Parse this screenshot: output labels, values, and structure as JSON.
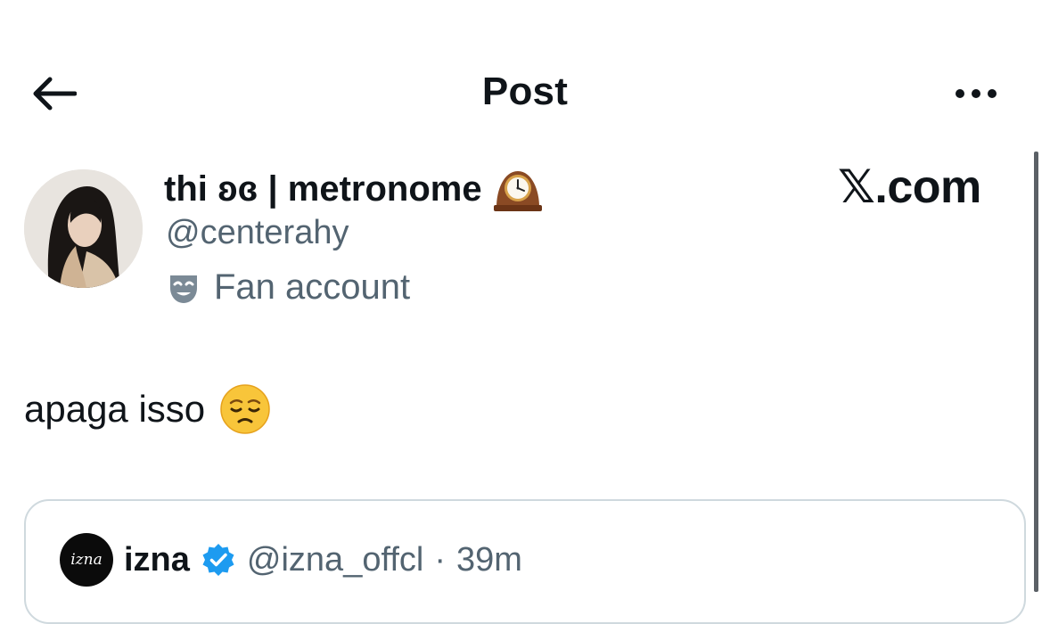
{
  "header": {
    "title": "Post",
    "back_icon": "arrow-left-icon",
    "more_icon": "ellipsis-horizontal-icon"
  },
  "author": {
    "display_name": "thi ʚɞ | metronome",
    "name_emoji": "🕰️",
    "handle": "@centerahy",
    "badge_icon": "theater-mask-icon",
    "badge_label": "Fan account"
  },
  "watermark": "𝕏.com",
  "post": {
    "text": "apaga isso",
    "emoji": "😩"
  },
  "quoted_post": {
    "avatar_text": "izna",
    "display_name": "izna",
    "verified_icon": "verified-badge-icon",
    "handle": "@izna_offcl",
    "separator": "·",
    "time": "39m"
  },
  "colors": {
    "text_primary": "#0f1419",
    "text_secondary": "#536471",
    "border": "#cfd9de",
    "verified_blue": "#1d9bf0"
  }
}
